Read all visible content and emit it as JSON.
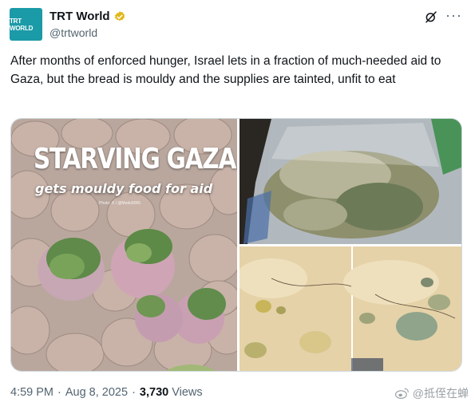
{
  "account": {
    "avatar_text": "TRT WORLD",
    "display_name": "TRT World",
    "handle": "@trtworld",
    "verified_icon": "verified-badge-gold-icon",
    "avatar_color": "#1b9aa7"
  },
  "actions": {
    "grok_icon": "grok-icon",
    "more_label": "···"
  },
  "tweet": {
    "text": "After months of enforced hunger, Israel lets in a fraction of much-needed aid to Gaza, but the bread is mouldy and the supplies are tainted, unfit to eat"
  },
  "media": {
    "left": {
      "title": "STARVING GAZA",
      "subtitle": "gets mouldy food for aid",
      "credit": "Photo: X / @Medo9065"
    }
  },
  "footer": {
    "time": "4:59 PM",
    "date": "Aug 8, 2025",
    "separator": "·",
    "views_count": "3,730",
    "views_label": "Views"
  },
  "watermark": {
    "text": "@抵侄在蝉"
  }
}
